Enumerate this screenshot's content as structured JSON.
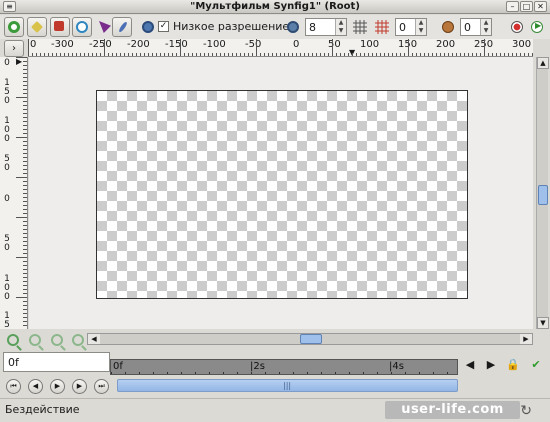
{
  "window": {
    "title": "\"Мультфильм Synfig1\" (Root)",
    "minimize_glyph": "–",
    "maximize_glyph": "□",
    "close_glyph": "✕"
  },
  "toolbar": {
    "low_res_label": "Низкое разрешение",
    "low_res_checked": "✓",
    "res_value": "8",
    "grid_value": "0",
    "onion_value": "0"
  },
  "ruler": {
    "toggle_glyph": "›",
    "h_labels": [
      "0",
      "-300",
      "-250",
      "-200",
      "-150",
      "-100",
      "-50",
      "0",
      "50",
      "100",
      "150",
      "200",
      "250",
      "300"
    ],
    "v_labels": [
      "0",
      "1",
      "5",
      "0",
      "1",
      "0",
      "0",
      "5",
      "0",
      "0",
      "5",
      "0",
      "1",
      "0",
      "0",
      "1",
      "5"
    ]
  },
  "time": {
    "current": "0f",
    "ticks": [
      "0f",
      "|2s",
      "|4s"
    ]
  },
  "status": {
    "text": "Бездействие",
    "watermark": "user-life.com"
  },
  "colors": {
    "accent_blue": "#9fc0ea",
    "zoom_green": "#58a05c",
    "checker": "#cccccc"
  }
}
